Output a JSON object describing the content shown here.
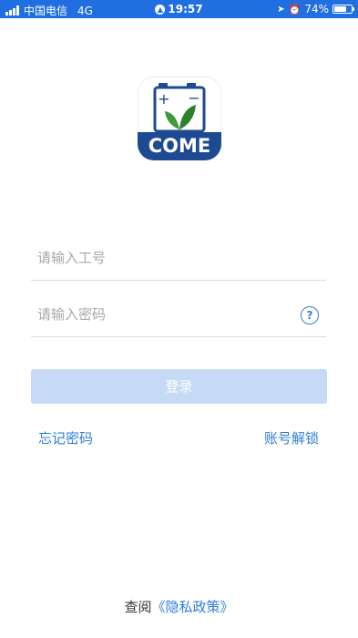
{
  "status_bar": {
    "carrier": "中国电信",
    "network": "4G",
    "time": "19:57",
    "battery": "74%",
    "battery_level": 0.74
  },
  "logo": {
    "text": "COME",
    "plus": "+",
    "minus": "−"
  },
  "login": {
    "username_placeholder": "请输入工号",
    "password_placeholder": "请输入密码",
    "help_symbol": "?",
    "submit_label": "登录",
    "forgot_password": "忘记密码",
    "unlock_account": "账号解锁"
  },
  "footer": {
    "view_prefix": "查阅",
    "privacy_link": "《隐私政策》"
  },
  "colors": {
    "status_bar_bg": "#1f6fe0",
    "accent": "#2f7ed8",
    "button_disabled": "#c6daf6",
    "logo_blue": "#1e4a93",
    "leaf_green": "#3e9a3a"
  }
}
